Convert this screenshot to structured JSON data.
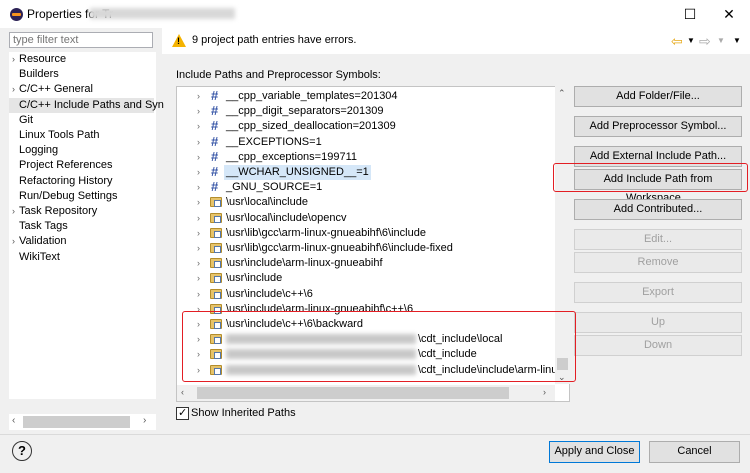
{
  "window": {
    "title": "Properties for Tr",
    "minimize_icon": "minimize-icon",
    "close_icon": "close-icon"
  },
  "sidebar": {
    "filter_placeholder": "type filter text",
    "items": [
      {
        "label": "Resource",
        "expandable": true
      },
      {
        "label": "Builders",
        "expandable": false
      },
      {
        "label": "C/C++ General",
        "expandable": true
      },
      {
        "label": "C/C++ Include Paths and Syn",
        "expandable": false,
        "selected": true
      },
      {
        "label": "Git",
        "expandable": false
      },
      {
        "label": "Linux Tools Path",
        "expandable": false
      },
      {
        "label": "Logging",
        "expandable": false
      },
      {
        "label": "Project References",
        "expandable": false
      },
      {
        "label": "Refactoring History",
        "expandable": false
      },
      {
        "label": "Run/Debug Settings",
        "expandable": false
      },
      {
        "label": "Task Repository",
        "expandable": true
      },
      {
        "label": "Task Tags",
        "expandable": false
      },
      {
        "label": "Validation",
        "expandable": true
      },
      {
        "label": "WikiText",
        "expandable": false
      }
    ]
  },
  "message": {
    "text": "9 project path entries have errors.",
    "icon": "warning-icon"
  },
  "main": {
    "section_label": "Include Paths and Preprocessor Symbols:",
    "entries": [
      {
        "type": "symbol",
        "text": "__cpp_variable_templates=201304"
      },
      {
        "type": "symbol",
        "text": "__cpp_digit_separators=201309"
      },
      {
        "type": "symbol",
        "text": "__cpp_sized_deallocation=201309"
      },
      {
        "type": "symbol",
        "text": "__EXCEPTIONS=1"
      },
      {
        "type": "symbol",
        "text": "__cpp_exceptions=199711"
      },
      {
        "type": "symbol",
        "text": "__WCHAR_UNSIGNED__=1",
        "highlighted": true
      },
      {
        "type": "symbol",
        "text": "_GNU_SOURCE=1"
      },
      {
        "type": "path",
        "text": "\\usr\\local\\include"
      },
      {
        "type": "path",
        "text": "\\usr\\local\\include\\opencv"
      },
      {
        "type": "path",
        "text": "\\usr\\lib\\gcc\\arm-linux-gnueabihf\\6\\include"
      },
      {
        "type": "path",
        "text": "\\usr\\lib\\gcc\\arm-linux-gnueabihf\\6\\include-fixed"
      },
      {
        "type": "path",
        "text": "\\usr\\include\\arm-linux-gnueabihf"
      },
      {
        "type": "path",
        "text": "\\usr\\include"
      },
      {
        "type": "path",
        "text": "\\usr\\include\\c++\\6"
      },
      {
        "type": "path",
        "text": "\\usr\\include\\arm-linux-gnueabihf\\c++\\6"
      },
      {
        "type": "path",
        "text": "\\usr\\include\\c++\\6\\backward"
      },
      {
        "type": "path",
        "text": "\\cdt_include\\local",
        "blurred_prefix": true
      },
      {
        "type": "path",
        "text": "\\cdt_include",
        "blurred_prefix": true
      },
      {
        "type": "path",
        "text": "\\cdt_include\\include\\arm-linu",
        "blurred_prefix": true
      }
    ],
    "show_inherited_label": "Show Inherited Paths",
    "show_inherited_checked": true
  },
  "buttons": {
    "add_folder": "Add Folder/File...",
    "add_preprocessor": "Add Preprocessor Symbol...",
    "add_external": "Add External Include Path...",
    "add_workspace": "Add Include Path from Workspace...",
    "add_contributed": "Add Contributed...",
    "edit": "Edit...",
    "remove": "Remove",
    "export": "Export",
    "up": "Up",
    "down": "Down",
    "apply_close": "Apply and Close",
    "cancel": "Cancel"
  },
  "colors": {
    "annotation_red": "#e31e24",
    "selection_blue": "#d5e7f8",
    "warning_yellow": "#f5b300"
  }
}
